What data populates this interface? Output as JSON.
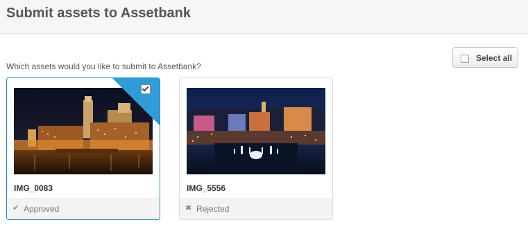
{
  "header": {
    "title": "Submit assets to Assetbank"
  },
  "main": {
    "prompt": "Which assets would you like to submit to Assetbank?",
    "select_all_label": "Select all",
    "assets": [
      {
        "name": "IMG_0083",
        "status_label": "Approved",
        "status_icon": "check-icon",
        "selected": true
      },
      {
        "name": "IMG_5556",
        "status_label": "Rejected",
        "status_icon": "x-icon",
        "selected": false
      }
    ]
  },
  "colors": {
    "selection_accent": "#2f9bd7",
    "selected_border": "#2a89bd"
  }
}
